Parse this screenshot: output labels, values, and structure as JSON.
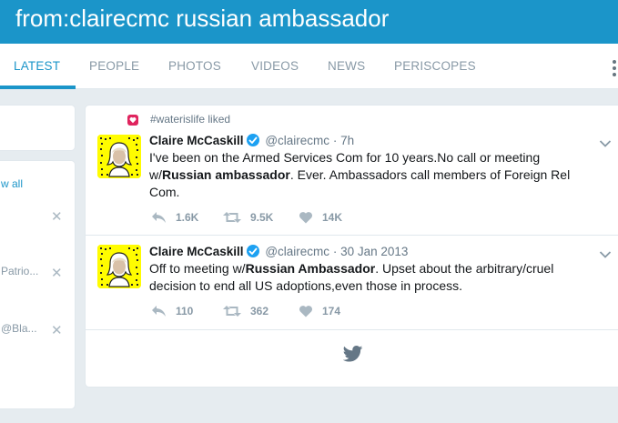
{
  "search": {
    "query": "from:clairecmc russian ambassador"
  },
  "tabs": [
    {
      "label": "LATEST",
      "active": true
    },
    {
      "label": "PEOPLE"
    },
    {
      "label": "PHOTOS"
    },
    {
      "label": "VIDEOS"
    },
    {
      "label": "NEWS"
    },
    {
      "label": "PERISCOPES"
    }
  ],
  "sidebar": {
    "view_all": "w all",
    "items": [
      "Patrio...",
      "@Bla..."
    ]
  },
  "tweets": [
    {
      "context": "#waterislife liked",
      "fullname": "Claire McCaskill",
      "username": "@clairecmc",
      "separator": "·",
      "timestamp": "7h",
      "text_before": "I've been on the Armed Services Com for 10 years.No call or meeting w/",
      "text_bold": "Russian ambassador",
      "text_after": ". Ever. Ambassadors call members of Foreign Rel Com.",
      "replies": "1.6K",
      "retweets": "9.5K",
      "likes": "14K"
    },
    {
      "fullname": "Claire McCaskill",
      "username": "@clairecmc",
      "separator": "·",
      "timestamp": "30 Jan 2013",
      "text_before": "Off to meeting w/",
      "text_bold": "Russian Ambassador",
      "text_after": ". Upset about the arbitrary/cruel decision to end all US adoptions,even those in process.",
      "replies": "110",
      "retweets": "362",
      "likes": "174"
    }
  ],
  "colors": {
    "header_bg": "#1b95c9",
    "accent": "#1b95c9",
    "like_red": "#e0245e",
    "verified_blue": "#1da1f2",
    "avatar_yellow": "#fffc00"
  }
}
